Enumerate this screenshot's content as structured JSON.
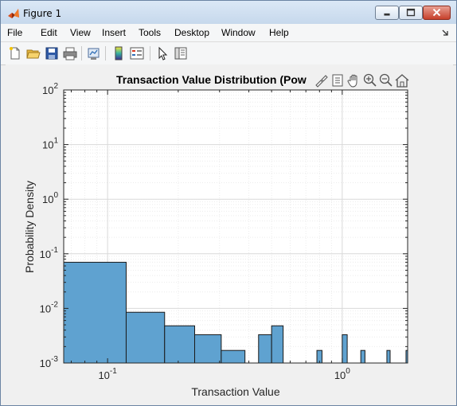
{
  "window": {
    "title": "Figure 1"
  },
  "menu": [
    "File",
    "Edit",
    "View",
    "Insert",
    "Tools",
    "Desktop",
    "Window",
    "Help"
  ],
  "toolbar": {
    "icons": [
      "new-figure-icon",
      "open-file-icon",
      "save-icon",
      "print-icon",
      "link-plot-icon",
      "insert-colorbar-icon",
      "insert-legend-icon",
      "edit-plot-icon",
      "property-inspector-icon"
    ]
  },
  "axes_toolbar": {
    "icons": [
      "brush-icon",
      "data-tips-icon",
      "pan-icon",
      "zoom-in-icon",
      "zoom-out-icon",
      "restore-view-icon"
    ]
  },
  "chart_data": {
    "type": "bar",
    "title": "Transaction Value Distribution (Pow",
    "xlabel": "Transaction Value",
    "ylabel": "Probability Density",
    "xscale": "log",
    "yscale": "log",
    "xlim": [
      0.065,
      1.9
    ],
    "ylim": [
      0.001,
      100
    ],
    "x_ticks": [
      {
        "value": 0.1,
        "base": "10",
        "exp": "-1"
      },
      {
        "value": 1,
        "base": "10",
        "exp": "0"
      }
    ],
    "y_ticks": [
      {
        "value": 0.001,
        "base": "10",
        "exp": "-3"
      },
      {
        "value": 0.01,
        "base": "10",
        "exp": "-2"
      },
      {
        "value": 0.1,
        "base": "10",
        "exp": "-1"
      },
      {
        "value": 1,
        "base": "10",
        "exp": "0"
      },
      {
        "value": 10,
        "base": "10",
        "exp": "1"
      },
      {
        "value": 100,
        "base": "10",
        "exp": "2"
      }
    ],
    "grid": true,
    "minor_grid": true,
    "bar_color": "#5fa2d0",
    "bins": [
      {
        "x0": 0.065,
        "x1": 0.12,
        "value": 0.07
      },
      {
        "x0": 0.12,
        "x1": 0.175,
        "value": 0.0085
      },
      {
        "x0": 0.175,
        "x1": 0.235,
        "value": 0.0048
      },
      {
        "x0": 0.235,
        "x1": 0.305,
        "value": 0.0033
      },
      {
        "x0": 0.305,
        "x1": 0.385,
        "value": 0.0017
      },
      {
        "x0": 0.44,
        "x1": 0.5,
        "value": 0.0033
      },
      {
        "x0": 0.5,
        "x1": 0.56,
        "value": 0.0048
      },
      {
        "x0": 0.78,
        "x1": 0.82,
        "value": 0.0017
      },
      {
        "x0": 1.0,
        "x1": 1.05,
        "value": 0.0033
      },
      {
        "x0": 1.2,
        "x1": 1.25,
        "value": 0.0017
      },
      {
        "x0": 1.55,
        "x1": 1.6,
        "value": 0.0017
      },
      {
        "x0": 1.87,
        "x1": 1.9,
        "value": 0.0017
      }
    ]
  }
}
